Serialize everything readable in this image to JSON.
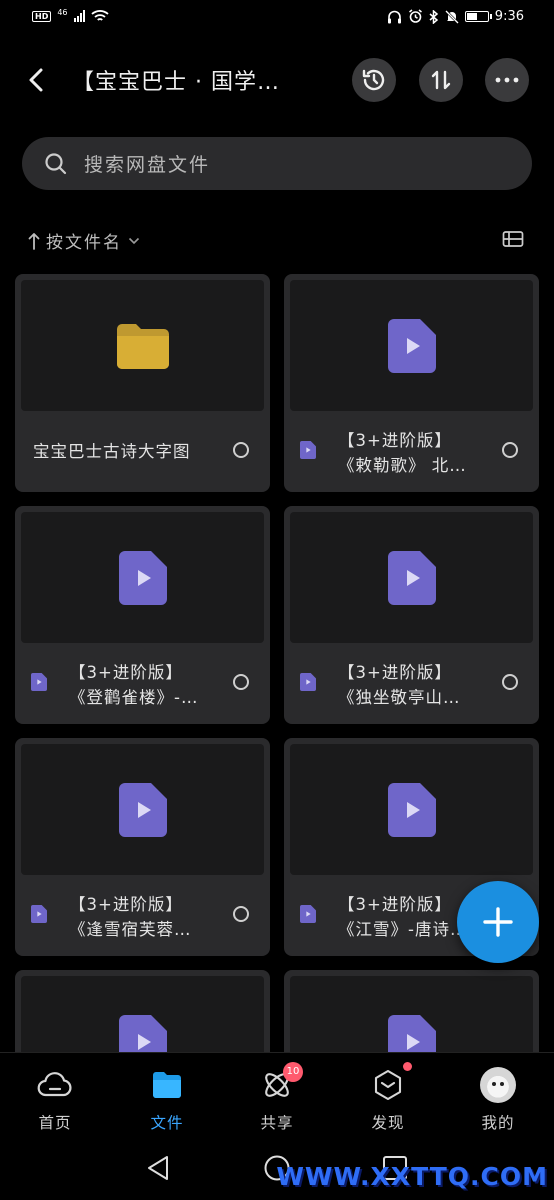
{
  "status_bar": {
    "time": "9:36",
    "network": "46",
    "hd": "HD",
    "battery_level": 0.45
  },
  "header": {
    "title": "【宝宝巴士 · 国学…"
  },
  "search": {
    "placeholder": "搜索网盘文件"
  },
  "sort": {
    "label": "按文件名"
  },
  "files": [
    {
      "type": "folder",
      "line1": "宝宝巴士古诗大字图",
      "line2": ""
    },
    {
      "type": "video",
      "line1": "【3+进阶版】",
      "line2": "《敕勒歌》 北…"
    },
    {
      "type": "video",
      "line1": "【3+进阶版】",
      "line2": "《登鹳雀楼》-…"
    },
    {
      "type": "video",
      "line1": "【3+进阶版】",
      "line2": "《独坐敬亭山…"
    },
    {
      "type": "video",
      "line1": "【3+进阶版】",
      "line2": "《逢雪宿芙蓉…"
    },
    {
      "type": "video",
      "line1": "【3+进阶版】",
      "line2": "《江雪》-唐诗…"
    },
    {
      "type": "video",
      "line1": "",
      "line2": ""
    },
    {
      "type": "video",
      "line1": "",
      "line2": ""
    }
  ],
  "tabs": [
    {
      "label": "首页",
      "icon": "cloud-icon",
      "active": false
    },
    {
      "label": "文件",
      "icon": "folder-icon",
      "active": true
    },
    {
      "label": "共享",
      "icon": "atom-icon",
      "active": false,
      "badge": "10"
    },
    {
      "label": "发现",
      "icon": "cube-icon",
      "active": false,
      "dot": true
    },
    {
      "label": "我的",
      "icon": "avatar",
      "active": false
    }
  ],
  "watermark": "WWW.XXTTQ.COM",
  "colors": {
    "accent": "#3aa6ff",
    "fab": "#1b8fe0",
    "video_icon": "#6f66c9",
    "folder_icon": "#d8ae35",
    "badge": "#ff5a6e"
  }
}
